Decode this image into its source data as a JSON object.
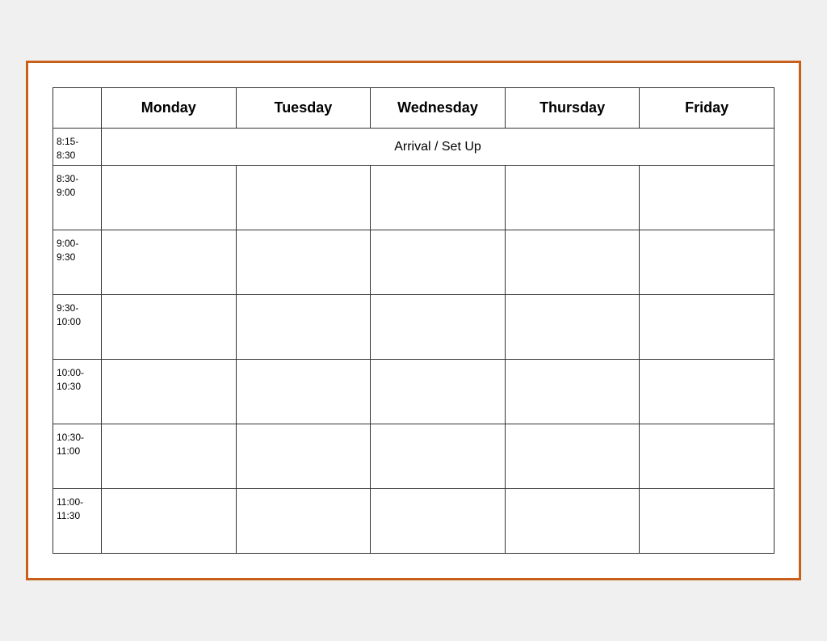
{
  "headers": {
    "time_col": "",
    "monday": "Monday",
    "tuesday": "Tuesday",
    "wednesday": "Wednesday",
    "thursday": "Thursday",
    "friday": "Friday"
  },
  "arrival_row": {
    "time": "8:15-\n8:30",
    "label": "Arrival / Set Up"
  },
  "time_slots": [
    "8:30-\n9:00",
    "9:00-\n9:30",
    "9:30-\n10:00",
    "10:00-\n10:30",
    "10:30-\n11:00",
    "11:00-\n11:30"
  ]
}
